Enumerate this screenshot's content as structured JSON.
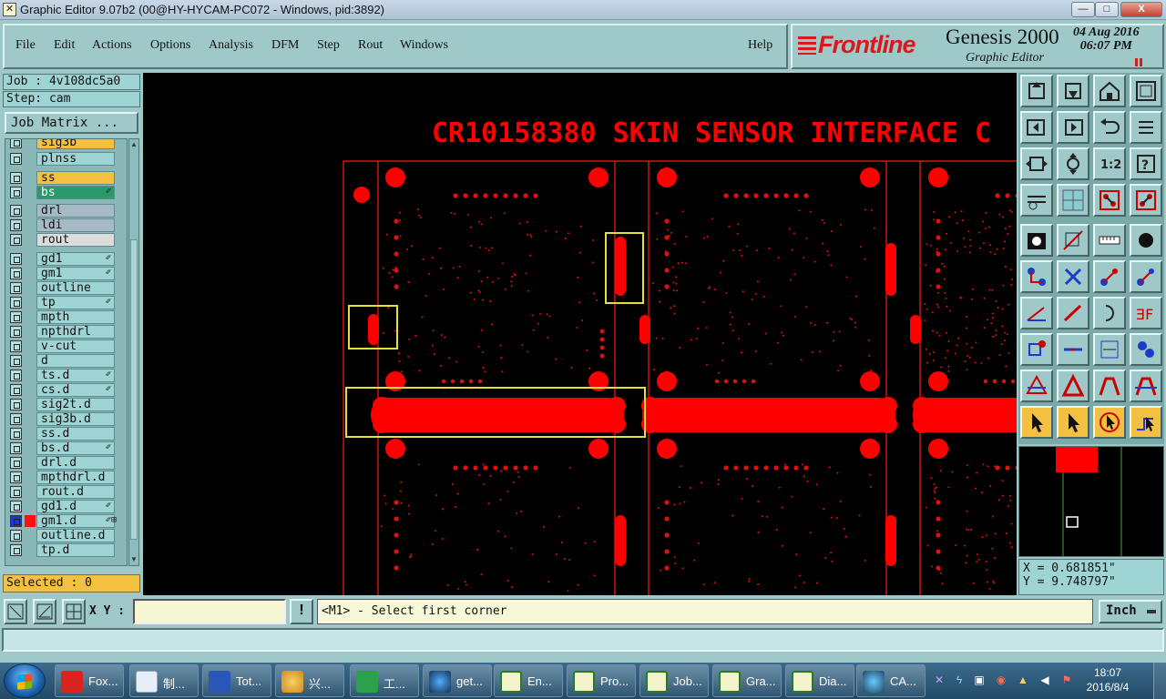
{
  "window": {
    "title": "Graphic Editor 9.07b2 (00@HY-HYCAM-PC072 - Windows, pid:3892)",
    "min": "—",
    "max": "□",
    "close": "X"
  },
  "menu": {
    "file": "File",
    "edit": "Edit",
    "actions": "Actions",
    "options": "Options",
    "analysis": "Analysis",
    "dfm": "DFM",
    "step": "Step",
    "rout": "Rout",
    "windows": "Windows",
    "help": "Help"
  },
  "brand": {
    "logo": "Frontline",
    "product": "Genesis 2000",
    "module": "Graphic Editor",
    "date": "04 Aug 2016",
    "time": "06:07 PM"
  },
  "job": {
    "job_line": "Job : 4v108dc5a0",
    "step_line": "Step: cam",
    "matrix_button": "Job Matrix ..."
  },
  "layers": [
    {
      "name": "sig3b",
      "color": "#f4c042",
      "mark": ""
    },
    {
      "name": "plnss",
      "color": "#9fd4d4",
      "mark": ""
    },
    {
      "name": "ss",
      "color": "#f4c042",
      "mark": ""
    },
    {
      "name": "bs",
      "color": "#2a9a6a",
      "mark": "✐"
    },
    {
      "name": "drl",
      "color": "#a7b9c4",
      "mark": ""
    },
    {
      "name": "ldi",
      "color": "#a7b9c4",
      "mark": ""
    },
    {
      "name": "rout",
      "color": "#dcdcdc",
      "mark": ""
    },
    {
      "name": "gd1",
      "color": "#9fd4d4",
      "mark": "✐"
    },
    {
      "name": "gm1",
      "color": "#9fd4d4",
      "mark": "✐"
    },
    {
      "name": "outline",
      "color": "#9fd4d4",
      "mark": ""
    },
    {
      "name": "tp",
      "color": "#9fd4d4",
      "mark": "✐"
    },
    {
      "name": "mpth",
      "color": "#9fd4d4",
      "mark": ""
    },
    {
      "name": "npthdrl",
      "color": "#9fd4d4",
      "mark": ""
    },
    {
      "name": "v-cut",
      "color": "#9fd4d4",
      "mark": ""
    },
    {
      "name": "d",
      "color": "#9fd4d4",
      "mark": ""
    },
    {
      "name": "ts.d",
      "color": "#9fd4d4",
      "mark": "✐"
    },
    {
      "name": "cs.d",
      "color": "#9fd4d4",
      "mark": "✐"
    },
    {
      "name": "sig2t.d",
      "color": "#9fd4d4",
      "mark": ""
    },
    {
      "name": "sig3b.d",
      "color": "#9fd4d4",
      "mark": ""
    },
    {
      "name": "ss.d",
      "color": "#9fd4d4",
      "mark": ""
    },
    {
      "name": "bs.d",
      "color": "#9fd4d4",
      "mark": "✐"
    },
    {
      "name": "drl.d",
      "color": "#9fd4d4",
      "mark": ""
    },
    {
      "name": "mpthdrl.d",
      "color": "#9fd4d4",
      "mark": ""
    },
    {
      "name": "rout.d",
      "color": "#9fd4d4",
      "mark": ""
    },
    {
      "name": "gd1.d",
      "color": "#9fd4d4",
      "mark": "✐"
    },
    {
      "name": "gm1.d",
      "color": "#9fd4d4",
      "mark": "✐⊞",
      "active": true
    },
    {
      "name": "outline.d",
      "color": "#9fd4d4",
      "mark": ""
    },
    {
      "name": "tp.d",
      "color": "#9fd4d4",
      "mark": ""
    }
  ],
  "selected": "Selected : 0",
  "canvas": {
    "board_title": "CR10158380 SKIN SENSOR INTERFACE C",
    "accent": "#ff0000",
    "highlight": "#e8e03a"
  },
  "coords": {
    "x": "X = 0.681851\"",
    "y": "Y = 9.748797\""
  },
  "bottom": {
    "xy_label": "X Y :",
    "xy_value": "",
    "bang": "!",
    "prompt": "<M1> - Select first corner",
    "units": "Inch"
  },
  "status": "",
  "taskbar": {
    "apps": [
      {
        "label": "Fox...",
        "icon": "foxit-icon"
      },
      {
        "label": "制...",
        "icon": "document-icon"
      },
      {
        "label": "Tot...",
        "icon": "save-disk-icon"
      },
      {
        "label": "兴...",
        "icon": "shell-icon"
      },
      {
        "label": "工...",
        "icon": "p-app-icon"
      },
      {
        "label": "get...",
        "icon": "eye-icon"
      },
      {
        "label": "En...",
        "icon": "genesis-window-icon"
      },
      {
        "label": "Pro...",
        "icon": "genesis-window-icon"
      },
      {
        "label": "Job...",
        "icon": "genesis-window-icon"
      },
      {
        "label": "Gra...",
        "icon": "genesis-window-icon"
      },
      {
        "label": "Dia...",
        "icon": "genesis-window-icon"
      },
      {
        "label": "CA...",
        "icon": "cam-icon"
      }
    ],
    "time": "18:07",
    "date": "2016/8/4"
  }
}
